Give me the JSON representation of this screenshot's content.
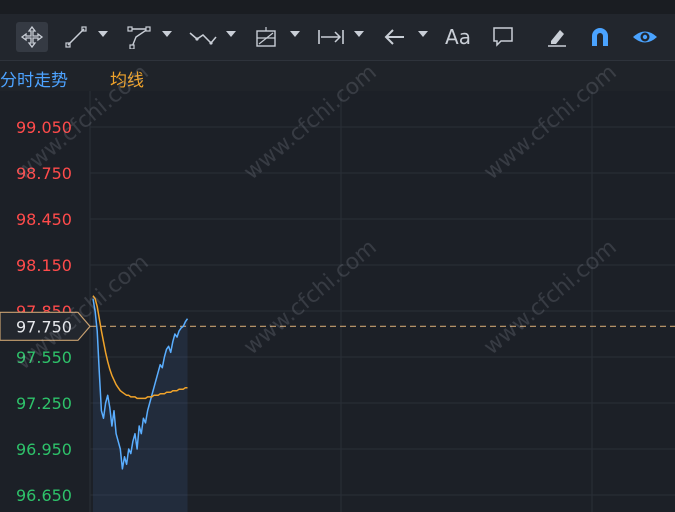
{
  "toolbar": {
    "tools": [
      {
        "name": "move-icon",
        "active": true
      },
      {
        "name": "trendline-icon",
        "active": false
      },
      {
        "name": "polyline-icon",
        "active": false
      },
      {
        "name": "wave-icon",
        "active": false
      },
      {
        "name": "fib-icon",
        "active": false
      },
      {
        "name": "measure-icon",
        "active": false
      },
      {
        "name": "arrow-left-icon",
        "active": false
      },
      {
        "name": "text-icon",
        "active": false,
        "glyph": "Aa"
      },
      {
        "name": "comment-icon",
        "active": false
      },
      {
        "name": "eraser-icon",
        "active": false
      },
      {
        "name": "magnet-icon",
        "active": false
      },
      {
        "name": "eye-icon",
        "active": false
      }
    ]
  },
  "legend": {
    "tab_label": "分时走势",
    "ma_label": "均线"
  },
  "watermark": "www.cfchi.com",
  "colors": {
    "background": "#1c2027",
    "price_line": "#5aaeff",
    "avg_line": "#f0a32a",
    "up_text": "#ff4b4b",
    "down_text": "#2ec26a",
    "ref_line": "#c8a070",
    "grid": "#2a2f37"
  },
  "chart_data": {
    "type": "line",
    "title": "",
    "xlabel": "",
    "ylabel": "",
    "ylim": [
      96.65,
      99.05
    ],
    "yticks": [
      "99.050",
      "98.750",
      "98.450",
      "98.150",
      "97.850",
      "97.550",
      "97.250",
      "96.950",
      "96.650"
    ],
    "reference_value": "97.750",
    "grid": true,
    "series": [
      {
        "x": [
          0,
          1,
          2,
          3,
          4,
          5,
          6,
          7,
          8,
          9,
          10,
          11,
          12,
          13,
          14,
          15,
          16,
          17,
          18,
          19,
          20,
          21,
          22,
          23,
          24,
          25,
          26,
          27,
          28,
          29,
          30,
          31,
          32,
          33,
          34,
          35,
          36,
          37,
          38,
          39,
          40,
          41,
          42,
          43,
          44,
          45
        ],
        "values": [
          97.93,
          97.85,
          97.72,
          97.45,
          97.2,
          97.15,
          97.25,
          97.3,
          97.22,
          97.1,
          97.2,
          97.05,
          97.0,
          96.95,
          96.82,
          96.9,
          96.85,
          96.95,
          96.92,
          97.0,
          97.05,
          96.95,
          97.1,
          97.05,
          97.15,
          97.12,
          97.2,
          97.25,
          97.3,
          97.35,
          97.4,
          97.45,
          97.5,
          97.48,
          97.55,
          97.6,
          97.62,
          97.58,
          97.65,
          97.7,
          97.68,
          97.72,
          97.74,
          97.75,
          97.78,
          97.8
        ]
      },
      {
        "x": [
          0,
          1,
          2,
          3,
          4,
          5,
          6,
          7,
          8,
          9,
          10,
          11,
          12,
          13,
          14,
          15,
          16,
          17,
          18,
          19,
          20,
          21,
          22,
          23,
          24,
          25,
          26,
          27,
          28,
          29,
          30,
          31,
          32,
          33,
          34,
          35,
          36,
          37,
          38,
          39,
          40,
          41,
          42,
          43,
          44,
          45
        ],
        "values": [
          97.95,
          97.93,
          97.88,
          97.8,
          97.72,
          97.65,
          97.58,
          97.52,
          97.47,
          97.43,
          97.4,
          97.37,
          97.35,
          97.33,
          97.32,
          97.31,
          97.3,
          97.3,
          97.29,
          97.29,
          97.29,
          97.28,
          97.28,
          97.28,
          97.28,
          97.28,
          97.29,
          97.29,
          97.29,
          97.3,
          97.3,
          97.3,
          97.31,
          97.31,
          97.31,
          97.32,
          97.32,
          97.32,
          97.33,
          97.33,
          97.33,
          97.34,
          97.34,
          97.34,
          97.35,
          97.35
        ]
      }
    ]
  }
}
